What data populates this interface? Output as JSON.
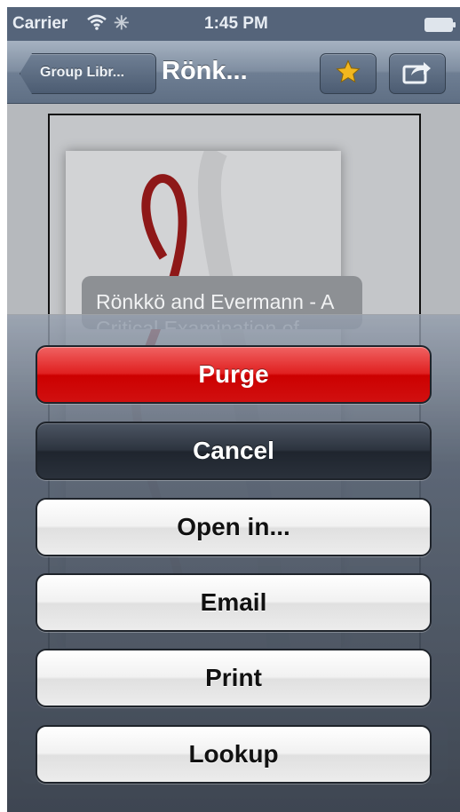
{
  "status_bar": {
    "carrier": "Carrier",
    "time": "1:45 PM",
    "wifi_icon": "wifi-icon",
    "activity_icon": "activity-spinner-icon",
    "battery_icon": "battery-icon"
  },
  "nav_bar": {
    "back_label": "Group Libr...",
    "title": "Rönk...",
    "star_icon": "star-icon",
    "share_icon": "share-icon",
    "star_color": "#f2b71f"
  },
  "document": {
    "popup_text": "Rönkkö and Evermann - A Critical Examination of"
  },
  "action_sheet": {
    "destructive_label": "Purge",
    "cancel_label": "Cancel",
    "options": [
      "Open in...",
      "Email",
      "Print",
      "Lookup"
    ]
  },
  "colors": {
    "destructive": "#d11010",
    "cancel": "#2d343f",
    "nav": "#6e7e93"
  }
}
